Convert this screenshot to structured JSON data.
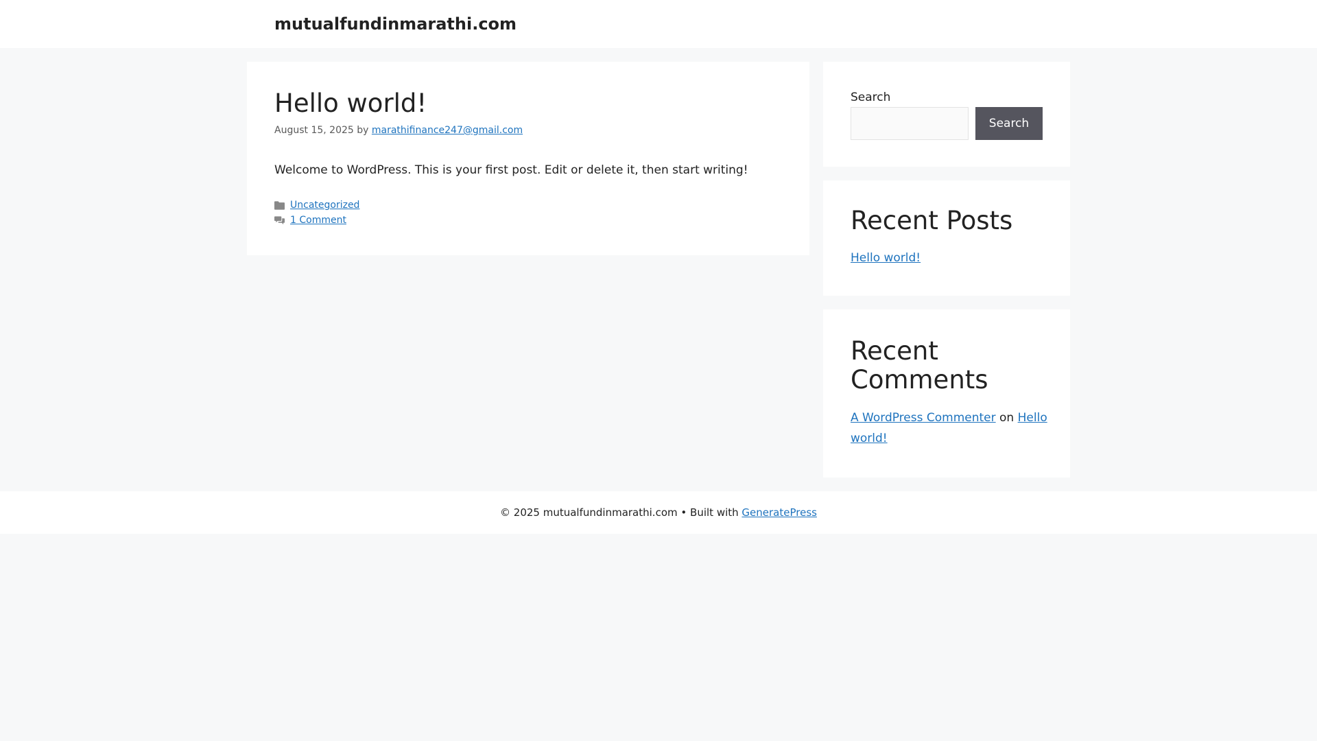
{
  "header": {
    "site_title": "mutualfundinmarathi.com"
  },
  "article": {
    "title": "Hello world!",
    "date": "August 15, 2025",
    "by_label": "by",
    "author": "marathifinance247@gmail.com",
    "content": "Welcome to WordPress. This is your first post. Edit or delete it, then start writing!",
    "category": "Uncategorized",
    "comments_link": "1 Comment",
    "category_icon": "folder-icon",
    "comments_icon": "comments-icon"
  },
  "sidebar": {
    "search": {
      "label": "Search",
      "input_value": "",
      "button_label": "Search"
    },
    "recent_posts": {
      "title": "Recent Posts",
      "items": [
        "Hello world!"
      ]
    },
    "recent_comments": {
      "title": "Recent Comments",
      "items": [
        {
          "author": "A WordPress Commenter",
          "on_label": "on",
          "post": "Hello world!"
        }
      ]
    }
  },
  "footer": {
    "copyright": "© 2025 mutualfundinmarathi.com",
    "separator": "•",
    "built_with": "Built with",
    "theme_link": "GeneratePress"
  },
  "colors": {
    "link": "#1e73be",
    "button_bg": "#55555e",
    "page_bg": "#f7f8f9",
    "card_bg": "#ffffff"
  }
}
